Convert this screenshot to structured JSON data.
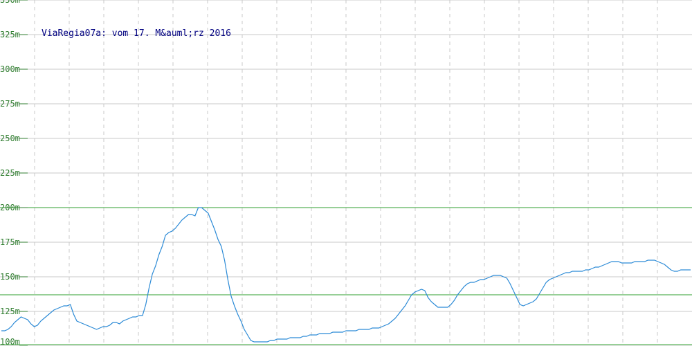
{
  "chart_data": {
    "type": "line",
    "title": "ViaRegia07a: vom 17. M&auml;rz 2016",
    "xlabel": "",
    "ylabel": "",
    "ylim": [
      100,
      350
    ],
    "y_ticks": [
      "100m",
      "125m",
      "150m",
      "175m",
      "200m",
      "225m",
      "250m",
      "275m",
      "300m",
      "325m",
      "350m"
    ],
    "grid": true,
    "reference_lines": [
      101,
      137,
      200
    ],
    "series": [
      {
        "values": [
          111,
          111,
          112,
          114,
          117,
          119,
          121,
          120,
          119,
          116,
          114,
          115,
          118,
          120,
          122,
          124,
          126,
          127,
          128,
          129,
          129,
          130,
          123,
          118,
          117,
          116,
          115,
          114,
          113,
          112,
          113,
          114,
          114,
          115,
          117,
          117,
          116,
          118,
          119,
          120,
          121,
          121,
          122,
          122,
          130,
          142,
          152,
          158,
          166,
          172,
          180,
          182,
          183,
          185,
          188,
          191,
          193,
          195,
          195,
          194,
          200,
          200,
          198,
          196,
          190,
          184,
          177,
          172,
          162,
          148,
          136,
          129,
          123,
          118,
          112,
          108,
          104,
          103,
          103,
          103,
          103,
          103,
          104,
          104,
          105,
          105,
          105,
          105,
          106,
          106,
          106,
          106,
          107,
          107,
          108,
          108,
          108,
          109,
          109,
          109,
          109,
          110,
          110,
          110,
          110,
          111,
          111,
          111,
          111,
          112,
          112,
          112,
          112,
          113,
          113,
          113,
          114,
          115,
          116,
          118,
          120,
          123,
          126,
          129,
          133,
          137,
          139,
          140,
          141,
          140,
          135,
          132,
          130,
          128,
          128,
          128,
          128,
          130,
          133,
          137,
          140,
          143,
          145,
          146,
          146,
          147,
          148,
          148,
          149,
          150,
          151,
          151,
          151,
          150,
          149,
          145,
          140,
          135,
          130,
          129,
          130,
          131,
          132,
          134,
          138,
          142,
          146,
          148,
          149,
          150,
          151,
          152,
          153,
          153,
          154,
          154,
          154,
          154,
          155,
          155,
          156,
          157,
          157,
          158,
          159,
          160,
          161,
          161,
          161,
          160,
          160,
          160,
          160,
          161,
          161,
          161,
          161,
          162,
          162,
          162,
          161,
          160,
          159,
          157,
          155,
          154,
          154,
          155,
          155,
          155,
          155
        ]
      }
    ]
  }
}
